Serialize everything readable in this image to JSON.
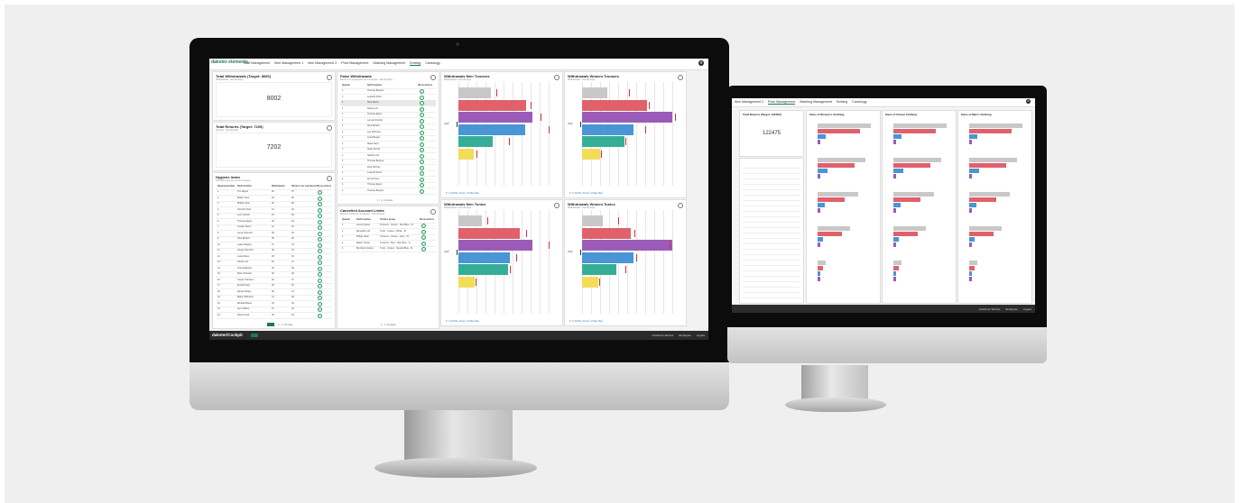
{
  "front": {
    "nav": {
      "logo": "dakster elements",
      "items": [
        "Staff Management",
        "Item Management 1",
        "Item Management 2",
        "Price Management",
        "Washing Management",
        "Embleg",
        "Cardology"
      ],
      "active_index": 5
    },
    "kpi1": {
      "title": "Total Withdrawals (Target: 8000)",
      "subtitle": "Withdrawals - last 30 days",
      "value": "8002"
    },
    "kpi2": {
      "title": "Total Returns (Target: 7200)",
      "subtitle": "Returns - last 30 days",
      "value": "7202"
    },
    "hygiene": {
      "title": "Hygiene Index",
      "subtitle": "All employees per active hit signs",
      "headers": [
        "Registered Date",
        "Staff member",
        "Withdrawals",
        "Returns not Laundered",
        "Show actions"
      ],
      "rows": [
        [
          "1",
          "Tim Mayes",
          "40",
          "37"
        ],
        [
          "2",
          "Martin Voss",
          "34",
          "36"
        ],
        [
          "3",
          "Philipp Stein",
          "46",
          "38"
        ],
        [
          "4",
          "Heinrich Park",
          "21",
          "19"
        ],
        [
          "5",
          "Leon Schulz",
          "24",
          "30"
        ],
        [
          "6",
          "Thomas Egner",
          "36",
          "29"
        ],
        [
          "7",
          "Joseph Wenn",
          "41",
          "36"
        ],
        [
          "8",
          "Jonas Schmidt",
          "39",
          "33"
        ],
        [
          "9",
          "Nina Bürkert",
          "35",
          "40"
        ],
        [
          "10",
          "Lukas Wagner",
          "37",
          "34"
        ],
        [
          "11",
          "Jürgen Heinrich",
          "30",
          "31"
        ],
        [
          "12",
          "Luisa Meyer",
          "28",
          "32"
        ],
        [
          "13",
          "Jakob Lutz",
          "32",
          "27"
        ],
        [
          "14",
          "Svenja Becker",
          "33",
          "38"
        ],
        [
          "15",
          "Marc Schuster",
          "30",
          "29"
        ],
        [
          "16",
          "Jasper Hofmann",
          "42",
          "37"
        ],
        [
          "17",
          "Emilia Kraus",
          "26",
          "30"
        ],
        [
          "18",
          "Daniel Krüger",
          "29",
          "31"
        ],
        [
          "19",
          "Marie Hoffmann",
          "31",
          "28"
        ],
        [
          "20",
          "Michael Bauer",
          "34",
          "33"
        ],
        [
          "21",
          "Jens Weber",
          "27",
          "30"
        ],
        [
          "22",
          "Robert Graf",
          "35",
          "36"
        ]
      ],
      "pagination": "1 - 1 / 20 rows"
    },
    "false_withdrawals": {
      "title": "False Withdrawals",
      "subtitle": "Returns of employees per employee - last 30 days",
      "headers": [
        "Quarter",
        "Staff member",
        "Show actions"
      ],
      "rows": [
        [
          "1",
          "Thomas Bergner"
        ],
        [
          "1",
          "Leopold Strom"
        ],
        [
          "1",
          "Sina Sachs"
        ],
        [
          "1",
          "Jakob Lutz"
        ],
        [
          "1",
          "Thomas Egner"
        ],
        [
          "1",
          "Lennart Fischer"
        ],
        [
          "1",
          "Nina Bürkert"
        ],
        [
          "1",
          "Lea Hofmann"
        ],
        [
          "1",
          "Linus Berger"
        ],
        [
          "1",
          "Maria Sanz"
        ],
        [
          "1",
          "Noah Schulz"
        ],
        [
          "1",
          "Sabine Lutz"
        ],
        [
          "1",
          "Thomas Bergner"
        ],
        [
          "1",
          "Paul Schmid"
        ],
        [
          "1",
          "Leopold Strom"
        ],
        [
          "1",
          "Anna Kraus"
        ],
        [
          "1",
          "Thomas Egner"
        ],
        [
          "1",
          "Thomas Bergner"
        ]
      ],
      "pagination": "1 - 1 / 2 entries"
    },
    "cancelled": {
      "title": "Cancelled Account Limits",
      "subtitle": "Returns Limits per employee - last 30 days",
      "headers": [
        "Quarter",
        "Staff member",
        "Clothes group",
        "Show actions"
      ],
      "rows": [
        [
          "1",
          "Liesel Krause",
          "Trousers - Unisex - Size Blue - M"
        ],
        [
          "1",
          "Benedikt Lutz",
          "Tunic - Unisex - White - M"
        ],
        [
          "1",
          "Philipp Stein",
          "Trousers - Unisex - Grey - XL"
        ],
        [
          "1",
          "Martin Tische",
          "Trousers - Men - Size Blue - S"
        ],
        [
          "1",
          "Bernhard Gruber",
          "Tunic - Unisex - Neutral Blue - M"
        ]
      ],
      "pagination": "1 - 1 / 5 pages"
    },
    "charts": [
      {
        "title": "Withdrawals Men Trousers",
        "subtitle": "Withdrawals - last 30 days",
        "ylabel": "Staff",
        "legend": "Tr. to 40 Min. 44 Ave. 47 Max: Max"
      },
      {
        "title": "Withdrawals Women Trousers",
        "subtitle": "Withdrawals - last 30 days",
        "ylabel": "Staff",
        "legend": "Tr. to 40 Min. 44 Ave. 47 Max: Max"
      },
      {
        "title": "Withdrawals Men Tunics",
        "subtitle": "Withdrawals - last 30 days",
        "ylabel": "Staff",
        "legend": "Tr. to 40 Min. 44 Ave. 47 Max: Max"
      },
      {
        "title": "Withdrawals Women Tunics",
        "subtitle": "Withdrawals - last 30 days",
        "ylabel": "Staff",
        "legend": "Tr. to 40 Min. 44 Ave. 47 Max: Max"
      }
    ],
    "footer": {
      "brand": "dakster/Cockpit",
      "right": [
        "Customer Service",
        "Employee",
        "Logout"
      ]
    }
  },
  "back": {
    "nav": {
      "items": [
        "Item Management 2",
        "Price Management",
        "Washing Management",
        "Embleg",
        "Cardology"
      ],
      "active_index": 1
    },
    "kpi": {
      "title": "Total Returns (Target: 122000)",
      "value": "122475"
    },
    "charts": [
      {
        "title": "Sizes of Women's Clothing"
      },
      {
        "title": "Sizes of Unisex Clothing"
      },
      {
        "title": "Sizes of Men's Clothing"
      }
    ],
    "footer": {
      "right": [
        "Customer Service",
        "Employee",
        "Logout"
      ]
    }
  },
  "chart_data": [
    {
      "type": "bar",
      "title": "Withdrawals Men Trousers",
      "categories": [
        "S",
        "M",
        "L",
        "XL",
        "XXL",
        "XS"
      ],
      "values": [
        36,
        75,
        82,
        74,
        38,
        17
      ],
      "markers": [
        42,
        80,
        91,
        100,
        56,
        20
      ],
      "xlim": [
        0,
        100
      ]
    },
    {
      "type": "bar",
      "title": "Withdrawals Women Trousers",
      "categories": [
        "S",
        "M",
        "L",
        "XL",
        "XXL",
        "XS"
      ],
      "values": [
        28,
        72,
        100,
        57,
        47,
        20
      ],
      "markers": [
        52,
        74,
        103,
        70,
        48,
        21
      ],
      "xlim": [
        0,
        100
      ]
    },
    {
      "type": "bar",
      "title": "Withdrawals Men Tunics",
      "categories": [
        "S",
        "M",
        "L",
        "XL",
        "XXL",
        "XS"
      ],
      "values": [
        26,
        68,
        82,
        57,
        55,
        18
      ],
      "markers": [
        32,
        75,
        100,
        64,
        57,
        19
      ],
      "xlim": [
        0,
        100
      ]
    },
    {
      "type": "bar",
      "title": "Withdrawals Women Tunics",
      "categories": [
        "S",
        "M",
        "L",
        "XL",
        "XXL",
        "XS"
      ],
      "values": [
        23,
        54,
        100,
        57,
        38,
        18
      ],
      "markers": [
        40,
        58,
        97,
        60,
        48,
        19
      ],
      "xlim": [
        0,
        100
      ]
    }
  ]
}
